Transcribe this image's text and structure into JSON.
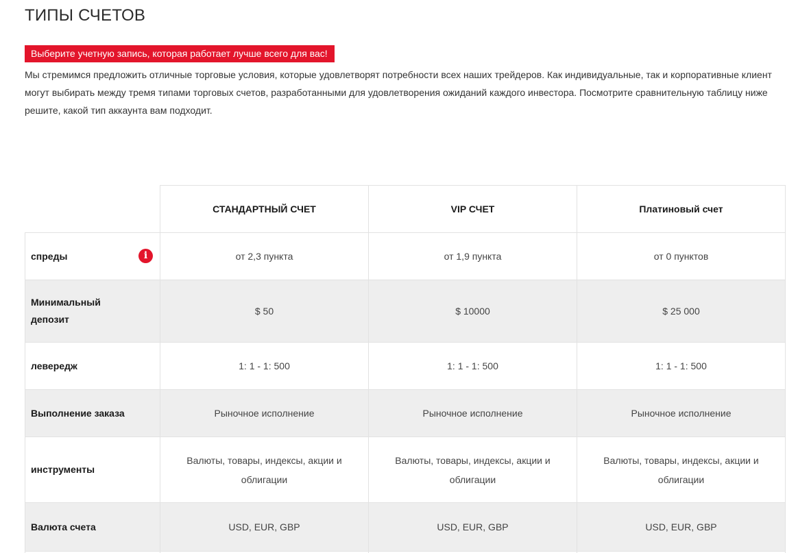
{
  "page": {
    "title": "ТИПЫ СЧЕТОВ",
    "banner": "Выберите учетную запись, которая работает лучше всего для вас!",
    "intro_lines": [
      "Мы стремимся предложить отличные торговые условия, которые удовлетворят потребности всех наших трейдеров. Как индивидуальные, так и корпоративные клиент",
      "могут выбирать между тремя типами торговых счетов, разработанными для удовлетворения ожиданий каждого инвестора. Посмотрите сравнительную таблицу ниже",
      "решите, какой тип аккаунта вам подходит."
    ]
  },
  "table": {
    "plans": [
      "СТАНДАРТНЫЙ СЧЕТ",
      "VIP СЧЕТ",
      "Платиновый счет"
    ],
    "rows": [
      {
        "label": "спреды",
        "info_icon": "info-icon",
        "values": [
          "от 2,3 пункта",
          "от 1,9 пункта",
          "от 0 пунктов"
        ]
      },
      {
        "label": "Минимальный депозит",
        "values": [
          "$ 50",
          "$ 10000",
          "$ 25 000"
        ]
      },
      {
        "label": "левередж",
        "values": [
          "1: 1 - 1: 500",
          "1: 1 - 1: 500",
          "1: 1 - 1: 500"
        ]
      },
      {
        "label": "Выполнение заказа",
        "values": [
          "Рыночное исполнение",
          "Рыночное исполнение",
          "Рыночное исполнение"
        ]
      },
      {
        "label": "инструменты",
        "values": [
          "Валюты, товары, индексы, акции и облигации",
          "Валюты, товары, индексы, акции и облигации",
          "Валюты, товары, индексы, акции и облигации"
        ]
      },
      {
        "label": "Валюта счета",
        "values": [
          "USD, EUR, GBP",
          "USD, EUR, GBP",
          "USD, EUR, GBP"
        ]
      }
    ]
  },
  "colors": {
    "accent": "#e3152b",
    "row_shade": "#eeeeee",
    "border": "#e2e2e2"
  }
}
